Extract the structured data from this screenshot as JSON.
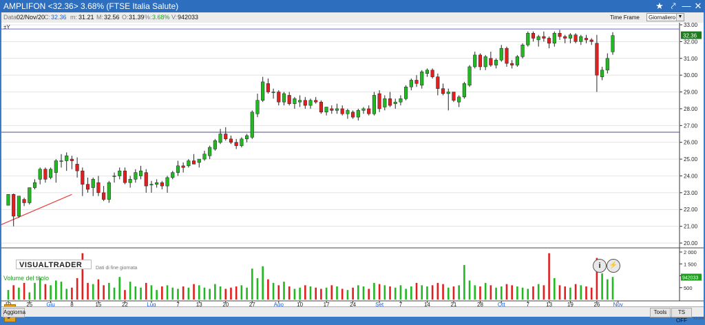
{
  "window": {
    "title": "AMPLIFON <32.36> 3.68%  (FTSE Italia Salute)",
    "star_icon": "star-icon",
    "wrench_icon": "wrench-icon",
    "minimize_icon": "minimize-icon",
    "close_icon": "close-icon"
  },
  "infobar": {
    "date_label": "Data:",
    "date": "02/Nov/20",
    "close_label": "C:",
    "close": "32.36",
    "min_label": "m:",
    "min": "31.21",
    "max_label": "M:",
    "max": "32.56",
    "open_label": "O:",
    "open": "31.39",
    "pct_label": "%:",
    "pct": "3.68%",
    "vol_label": "V:",
    "vol": "942033",
    "timeframe_label": "Time Frame",
    "timeframe_value": "Giornaliero"
  },
  "chart": {
    "corner_mark": "±Y",
    "logo": "VISUALTRADER",
    "logo_note": "Dati di fine giornata",
    "info_button": "i",
    "bolt_button": "⚡",
    "volume_label": "Volume del titolo",
    "last_price_tag": "32.36",
    "last_volume_tag": "942033",
    "zoom": "x1000",
    "colors": {
      "up": "#22b822",
      "down": "#e02020",
      "hline_top": "#6a6ad8",
      "hline_mid": "#4a4a8a",
      "trend": "#e84040"
    }
  },
  "chart_data": {
    "type": "candlestick",
    "ylim": [
      20,
      33
    ],
    "yticks": [
      "20.00",
      "21.00",
      "22.00",
      "23.00",
      "24.00",
      "25.00",
      "26.00",
      "27.00",
      "28.00",
      "29.00",
      "30.00",
      "31.00",
      "32.00",
      "33.00"
    ],
    "volume_ticks": [
      "2 000",
      "1 500",
      "1 000",
      "500"
    ],
    "volume_ylim": [
      0,
      2000
    ],
    "xticks": [
      "19",
      "25",
      "Giu",
      "8",
      "15",
      "22",
      "Lug",
      "7",
      "13",
      "20",
      "27",
      "Ago",
      "10",
      "17",
      "24",
      "Set",
      "7",
      "14",
      "21",
      "28",
      "Ott",
      "7",
      "13",
      "19",
      "26",
      "Nov"
    ],
    "xtick_candle_index": [
      0,
      4,
      8,
      12,
      17,
      22,
      27,
      32,
      36,
      41,
      46,
      51,
      55,
      60,
      65,
      70,
      74,
      79,
      84,
      89,
      93,
      98,
      102,
      106,
      111,
      115
    ],
    "hlines": [
      32.75,
      26.6
    ],
    "trendline": [
      [
        0,
        21.1
      ],
      [
        12,
        22.9
      ]
    ],
    "candles": [
      [
        22.25,
        22.9,
        22.25,
        22.9
      ],
      [
        22.9,
        22.95,
        21.0,
        21.6
      ],
      [
        21.6,
        22.8,
        21.5,
        22.8
      ],
      [
        22.6,
        22.7,
        22.2,
        22.4
      ],
      [
        22.4,
        23.3,
        22.3,
        23.3
      ],
      [
        23.3,
        23.8,
        23.2,
        23.6
      ],
      [
        23.8,
        24.5,
        23.5,
        24.4
      ],
      [
        24.4,
        24.5,
        23.6,
        23.8
      ],
      [
        23.9,
        24.5,
        23.8,
        24.4
      ],
      [
        24.2,
        25.0,
        23.6,
        24.9
      ],
      [
        24.9,
        25.3,
        24.5,
        24.9
      ],
      [
        24.9,
        25.4,
        24.3,
        25.2
      ],
      [
        25.0,
        25.2,
        24.4,
        24.9
      ],
      [
        24.7,
        25.1,
        23.9,
        24.3
      ],
      [
        24.3,
        24.5,
        22.8,
        23.5
      ],
      [
        23.5,
        23.9,
        23.0,
        23.2
      ],
      [
        23.3,
        23.9,
        22.8,
        23.8
      ],
      [
        23.6,
        24.0,
        22.8,
        23.0
      ],
      [
        23.0,
        23.4,
        22.5,
        22.6
      ],
      [
        22.6,
        23.7,
        22.4,
        23.6
      ],
      [
        24.0,
        24.2,
        23.6,
        24.0
      ],
      [
        24.0,
        24.5,
        23.8,
        24.3
      ],
      [
        24.3,
        24.5,
        23.5,
        23.6
      ],
      [
        23.6,
        24.0,
        23.3,
        23.8
      ],
      [
        23.8,
        24.4,
        23.6,
        24.2
      ],
      [
        24.0,
        24.6,
        23.8,
        24.3
      ],
      [
        24.2,
        24.4,
        23.0,
        23.4
      ],
      [
        23.5,
        23.7,
        23.0,
        23.5
      ],
      [
        23.5,
        23.8,
        23.3,
        23.6
      ],
      [
        23.6,
        23.7,
        23.2,
        23.4
      ],
      [
        23.4,
        24.0,
        23.0,
        23.9
      ],
      [
        23.9,
        24.3,
        23.8,
        24.2
      ],
      [
        24.2,
        24.9,
        24.0,
        24.6
      ],
      [
        24.6,
        24.8,
        24.2,
        24.5
      ],
      [
        24.6,
        25.0,
        24.5,
        24.9
      ],
      [
        24.9,
        25.3,
        24.7,
        24.7
      ],
      [
        24.8,
        25.0,
        24.5,
        25.0
      ],
      [
        25.0,
        25.5,
        24.9,
        25.3
      ],
      [
        25.2,
        25.8,
        25.0,
        25.7
      ],
      [
        25.6,
        26.2,
        25.5,
        26.1
      ],
      [
        26.0,
        26.8,
        25.9,
        26.5
      ],
      [
        26.5,
        26.9,
        26.1,
        26.2
      ],
      [
        26.2,
        26.4,
        25.9,
        26.0
      ],
      [
        26.0,
        26.2,
        25.6,
        25.8
      ],
      [
        25.8,
        26.3,
        25.7,
        26.2
      ],
      [
        26.2,
        26.5,
        26.0,
        26.4
      ],
      [
        26.3,
        27.9,
        26.2,
        27.8
      ],
      [
        27.7,
        28.9,
        27.5,
        28.5
      ],
      [
        28.5,
        29.9,
        28.4,
        29.6
      ],
      [
        29.5,
        29.8,
        28.9,
        29.0
      ],
      [
        29.0,
        29.2,
        28.6,
        29.0
      ],
      [
        29.0,
        29.1,
        28.2,
        28.4
      ],
      [
        28.4,
        29.0,
        28.2,
        28.9
      ],
      [
        28.8,
        29.0,
        28.2,
        28.3
      ],
      [
        28.3,
        28.7,
        28.0,
        28.6
      ],
      [
        28.4,
        28.8,
        28.1,
        28.5
      ],
      [
        28.5,
        28.7,
        28.0,
        28.2
      ],
      [
        28.2,
        28.6,
        28.0,
        28.5
      ],
      [
        28.5,
        28.7,
        28.3,
        28.4
      ],
      [
        28.4,
        28.5,
        27.7,
        27.8
      ],
      [
        27.8,
        28.1,
        27.6,
        28.1
      ],
      [
        28.0,
        28.2,
        27.7,
        27.9
      ],
      [
        27.9,
        28.3,
        27.7,
        28.0
      ],
      [
        28.0,
        28.2,
        27.6,
        27.7
      ],
      [
        27.7,
        28.0,
        27.4,
        27.9
      ],
      [
        27.8,
        27.9,
        27.4,
        27.5
      ],
      [
        27.5,
        28.0,
        27.3,
        27.9
      ],
      [
        27.9,
        28.1,
        27.7,
        28.0
      ],
      [
        28.0,
        28.2,
        27.6,
        27.7
      ],
      [
        27.7,
        29.0,
        27.6,
        28.8
      ],
      [
        28.9,
        29.1,
        27.8,
        28.0
      ],
      [
        28.1,
        28.8,
        27.9,
        28.6
      ],
      [
        28.6,
        29.0,
        28.1,
        28.2
      ],
      [
        28.3,
        28.6,
        28.0,
        28.4
      ],
      [
        28.4,
        28.8,
        28.2,
        28.6
      ],
      [
        28.6,
        29.4,
        28.5,
        29.3
      ],
      [
        29.3,
        29.8,
        29.1,
        29.7
      ],
      [
        29.7,
        30.0,
        29.3,
        29.5
      ],
      [
        29.4,
        30.3,
        29.2,
        30.2
      ],
      [
        30.1,
        30.4,
        29.9,
        30.3
      ],
      [
        30.3,
        30.4,
        29.8,
        29.9
      ],
      [
        29.9,
        30.1,
        28.8,
        29.2
      ],
      [
        29.2,
        29.5,
        28.8,
        28.9
      ],
      [
        28.9,
        29.2,
        27.9,
        29.0
      ],
      [
        29.0,
        29.0,
        28.4,
        28.5
      ],
      [
        28.4,
        28.8,
        28.1,
        28.7
      ],
      [
        28.7,
        29.6,
        28.6,
        29.5
      ],
      [
        29.4,
        30.6,
        29.3,
        30.5
      ],
      [
        30.5,
        31.4,
        30.4,
        31.2
      ],
      [
        31.2,
        31.3,
        30.3,
        30.5
      ],
      [
        30.5,
        31.2,
        30.3,
        31.1
      ],
      [
        31.0,
        31.4,
        30.5,
        30.6
      ],
      [
        30.6,
        31.0,
        30.4,
        30.9
      ],
      [
        30.9,
        31.8,
        30.8,
        31.6
      ],
      [
        31.6,
        31.7,
        30.5,
        30.7
      ],
      [
        30.7,
        30.9,
        30.4,
        30.6
      ],
      [
        30.6,
        31.2,
        30.5,
        31.1
      ],
      [
        31.1,
        31.9,
        31.0,
        31.8
      ],
      [
        31.8,
        32.6,
        31.7,
        32.5
      ],
      [
        32.5,
        32.6,
        32.0,
        32.2
      ],
      [
        32.1,
        32.4,
        31.7,
        32.3
      ],
      [
        32.3,
        32.6,
        32.0,
        32.2
      ],
      [
        32.2,
        32.3,
        31.6,
        31.9
      ],
      [
        31.9,
        32.6,
        31.7,
        32.5
      ],
      [
        32.5,
        32.7,
        32.1,
        32.3
      ],
      [
        32.3,
        32.4,
        31.9,
        32.2
      ],
      [
        32.2,
        32.5,
        31.9,
        32.4
      ],
      [
        32.4,
        32.5,
        31.9,
        32.0
      ],
      [
        32.0,
        32.4,
        31.8,
        32.3
      ],
      [
        32.2,
        32.4,
        31.9,
        32.1
      ],
      [
        32.1,
        32.2,
        31.8,
        32.0
      ],
      [
        31.9,
        32.4,
        29.0,
        30.0
      ],
      [
        29.9,
        30.5,
        29.7,
        30.3
      ],
      [
        30.3,
        31.3,
        30.1,
        31.0
      ],
      [
        31.39,
        32.56,
        31.21,
        32.36
      ]
    ],
    "volume": [
      400,
      600,
      500,
      700,
      300,
      700,
      900,
      650,
      600,
      800,
      750,
      450,
      500,
      900,
      1950,
      700,
      650,
      850,
      600,
      700,
      500,
      950,
      400,
      750,
      550,
      500,
      700,
      600,
      400,
      550,
      600,
      500,
      450,
      550,
      500,
      650,
      600,
      500,
      450,
      650,
      550,
      450,
      500,
      550,
      600,
      500,
      1300,
      900,
      1400,
      850,
      700,
      600,
      750,
      550,
      450,
      500,
      600,
      550,
      500,
      450,
      500,
      600,
      550,
      450,
      400,
      500,
      600,
      550,
      450,
      700,
      650,
      600,
      550,
      500,
      600,
      450,
      550,
      700,
      600,
      550,
      600,
      700,
      650,
      500,
      550,
      600,
      1450,
      800,
      600,
      550,
      700,
      600,
      500,
      550,
      650,
      600,
      550,
      500,
      450,
      550,
      650,
      600,
      1950,
      900,
      600,
      550,
      500,
      650,
      600,
      550,
      500,
      1750,
      1100,
      850,
      950
    ]
  },
  "bottombar": {
    "left_button": "Aggiorna",
    "tools_button": "Tools",
    "ts_button": "TS OFF"
  }
}
